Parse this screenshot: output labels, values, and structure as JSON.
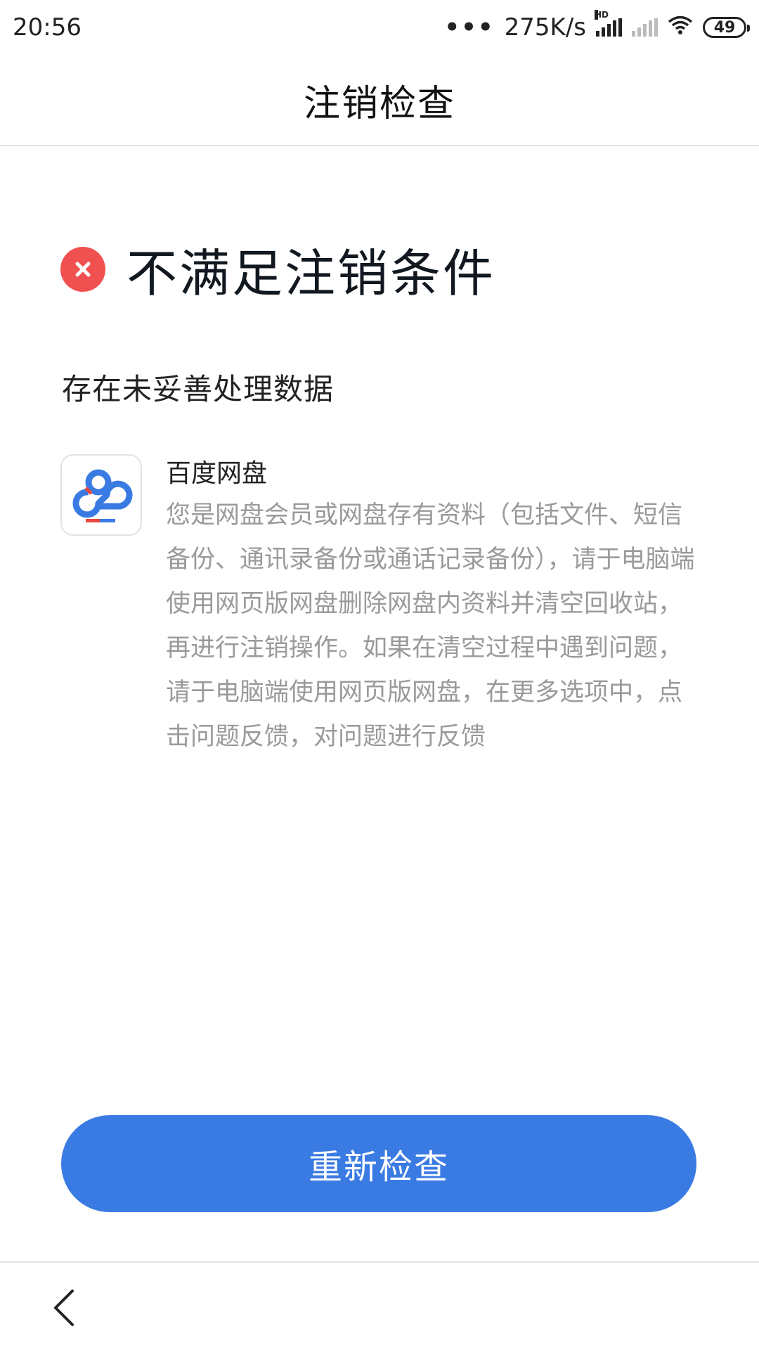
{
  "status_bar": {
    "time": "20:56",
    "dots": "•••",
    "network_speed": "275K/s",
    "hd_badge": "HD",
    "battery_level": "49"
  },
  "header": {
    "title": "注销检查"
  },
  "result": {
    "title": "不满足注销条件",
    "icon": "error-x-icon",
    "accent_color": "#f0504f"
  },
  "section": {
    "title": "存在未妥善处理数据"
  },
  "items": [
    {
      "app_name": "百度网盘",
      "icon": "baidu-netdisk-icon",
      "description": "您是网盘会员或网盘存有资料（包括文件、短信备份、通讯录备份或通话记录备份），请于电脑端使用网页版网盘删除网盘内资料并清空回收站，再进行注销操作。如果在清空过程中遇到问题，请于电脑端使用网页版网盘，在更多选项中，点击问题反馈，对问题进行反馈"
    }
  ],
  "actions": {
    "recheck_label": "重新检查",
    "button_color": "#3a7be3"
  },
  "nav": {
    "back_icon": "chevron-left-icon"
  }
}
